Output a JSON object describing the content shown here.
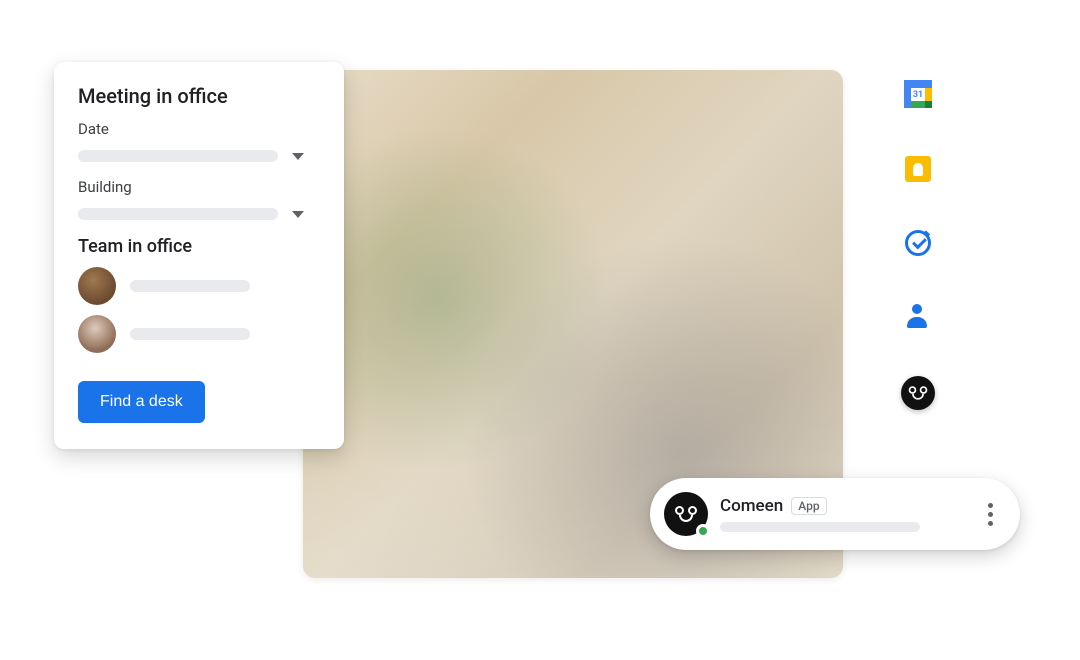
{
  "card": {
    "title": "Meeting in office",
    "date_label": "Date",
    "building_label": "Building",
    "team_title": "Team in office",
    "cta_label": "Find a desk"
  },
  "rail": {
    "calendar_day": "31",
    "icons": {
      "calendar": "calendar-icon",
      "keep": "keep-icon",
      "tasks": "tasks-icon",
      "contacts": "contacts-icon",
      "comeen": "comeen-icon"
    }
  },
  "chip": {
    "name": "Comeen",
    "badge": "App"
  }
}
